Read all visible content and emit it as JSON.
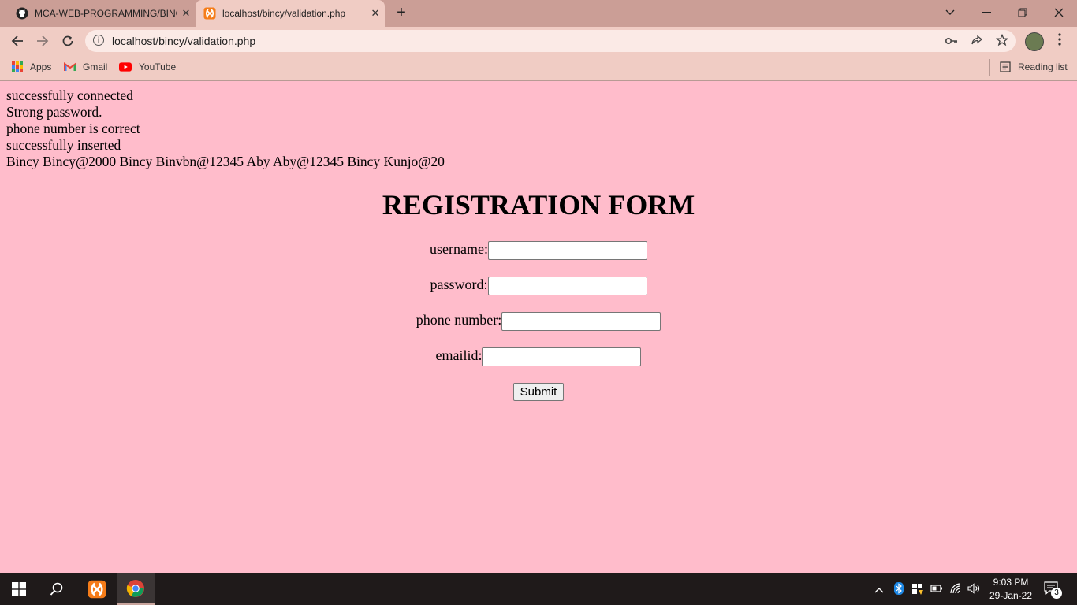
{
  "browser": {
    "tabs": [
      {
        "title": "MCA-WEB-PROGRAMMING/BINC",
        "close": "✕",
        "icon": "github-icon"
      },
      {
        "title": "localhost/bincy/validation.php",
        "close": "✕",
        "icon": "xampp-icon"
      }
    ],
    "new_tab": "+",
    "url": "localhost/bincy/validation.php",
    "bookmarks": [
      {
        "label": "Apps",
        "icon": "apps-grid-icon"
      },
      {
        "label": "Gmail",
        "icon": "gmail-icon"
      },
      {
        "label": "YouTube",
        "icon": "youtube-icon"
      }
    ],
    "reading_list": "Reading list"
  },
  "page": {
    "messages": [
      "successfully connected",
      "Strong password.",
      "phone number is correct",
      "successfully inserted",
      "Bincy Bincy@2000 Bincy Binvbn@12345 Aby Aby@12345 Bincy Kunjo@20"
    ],
    "form_title": "REGISTRATION FORM",
    "fields": [
      {
        "label": "username:",
        "value": ""
      },
      {
        "label": "password:",
        "value": ""
      },
      {
        "label": "phone number:",
        "value": ""
      },
      {
        "label": "emailid:",
        "value": ""
      }
    ],
    "submit_label": "Submit"
  },
  "taskbar": {
    "time": "9:03 PM",
    "date": "29-Jan-22",
    "notification_count": "3"
  },
  "colors": {
    "page_background": "#ffbccb",
    "tabbar": "#cb9e96",
    "toolbar": "#f0ccc4",
    "taskbar": "#1f1a1a"
  }
}
